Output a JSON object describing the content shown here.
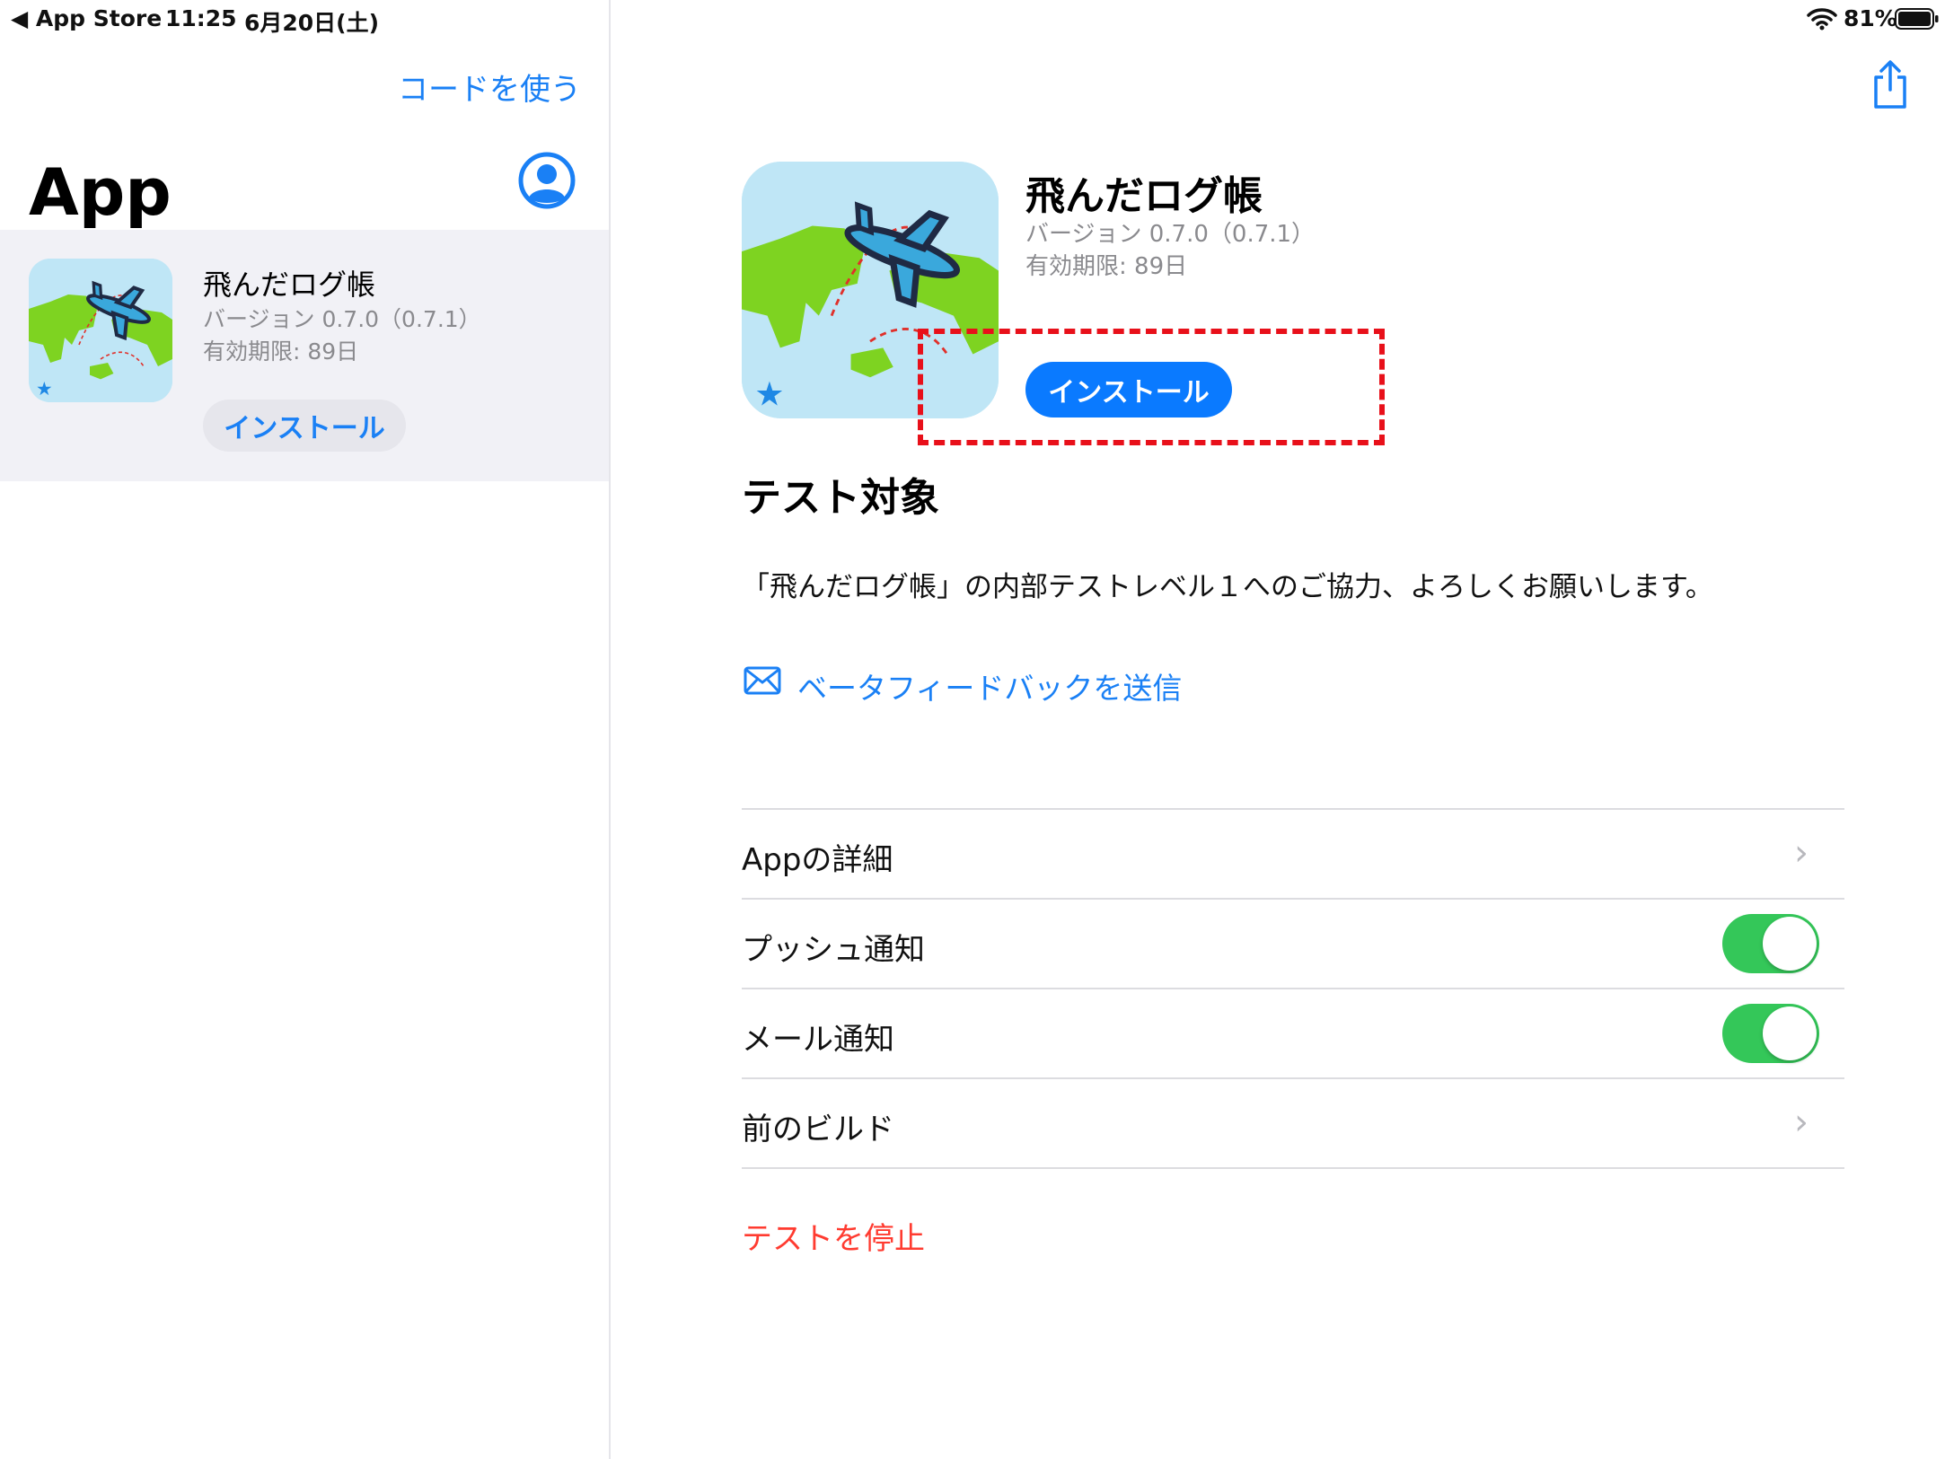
{
  "status_bar": {
    "back_app": "◀ App Store",
    "time": "11:25",
    "date": "6月20日(土)",
    "battery_percent": "81%",
    "battery_level": 0.81
  },
  "sidebar": {
    "redeem_link": "コードを使う",
    "title": "App",
    "app": {
      "name": "飛んだログ帳",
      "version": "バージョン 0.7.0（0.7.1）",
      "expiry": "有効期限: 89日",
      "install_label": "インストール"
    }
  },
  "detail": {
    "app": {
      "name": "飛んだログ帳",
      "version": "バージョン 0.7.0（0.7.1）",
      "expiry": "有効期限: 89日",
      "install_label": "インストール"
    },
    "section_title": "テスト対象",
    "description": "「飛んだログ帳」の内部テストレベル１へのご協力、よろしくお願いします。",
    "feedback_link": "ベータフィードバックを送信",
    "rows": [
      {
        "label": "Appの詳細",
        "type": "chevron"
      },
      {
        "label": "プッシュ通知",
        "type": "toggle",
        "on": true
      },
      {
        "label": "メール通知",
        "type": "toggle",
        "on": true
      },
      {
        "label": "前のビルド",
        "type": "chevron"
      }
    ],
    "stop_testing": "テストを停止"
  },
  "colors": {
    "accent": "#1a80f5",
    "install_button_bg": "#0a7aff",
    "toggle_on": "#34c759",
    "destructive": "#ff3b30",
    "highlight_box": "#e8101a"
  }
}
